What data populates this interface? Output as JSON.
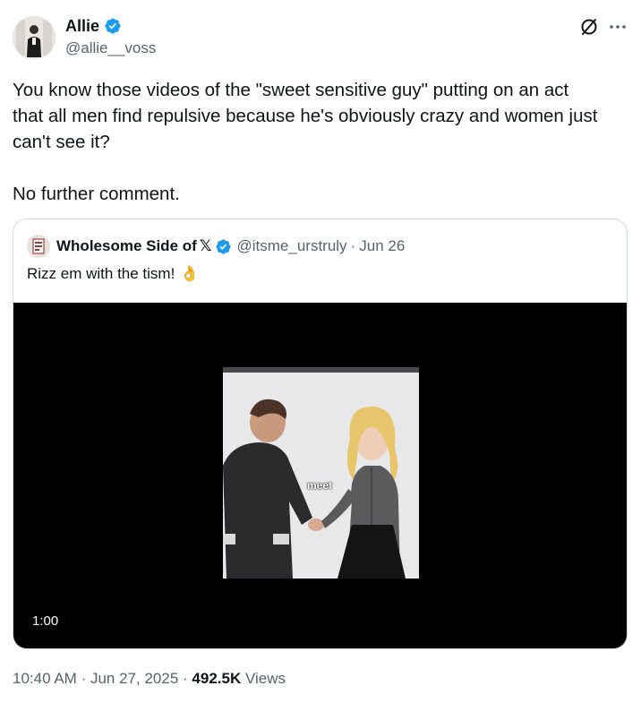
{
  "author": {
    "name": "Allie",
    "handle": "@allie__voss",
    "verified": true,
    "avatar_icon": "person-avatar"
  },
  "actions": {
    "grok_icon": "grok-icon",
    "more_icon": "more-dots-icon"
  },
  "tweet": {
    "lines": [
      "You know those videos of the \"sweet sensitive guy\" putting on an act",
      "that all men find repulsive because he's obviously crazy and women just",
      "can't see it?",
      "",
      "No further comment."
    ]
  },
  "quote": {
    "name": "Wholesome Side of",
    "x_mark": "𝕏",
    "handle": "@itsme_urstruly",
    "separator": "·",
    "date": "Jun 26",
    "text": "Rizz em with the tism!",
    "emoji": "👌",
    "video": {
      "caption": "meet",
      "duration": "1:00"
    }
  },
  "footer": {
    "time": "10:40 AM",
    "dot1": "·",
    "date": "Jun 27, 2025",
    "dot2": "·",
    "views_count": "492.5K",
    "views_label": "Views"
  },
  "colors": {
    "verified_blue": "#1d9bf0",
    "secondary_text": "#536471",
    "primary_text": "#0f1419",
    "border": "#cfd9de"
  }
}
